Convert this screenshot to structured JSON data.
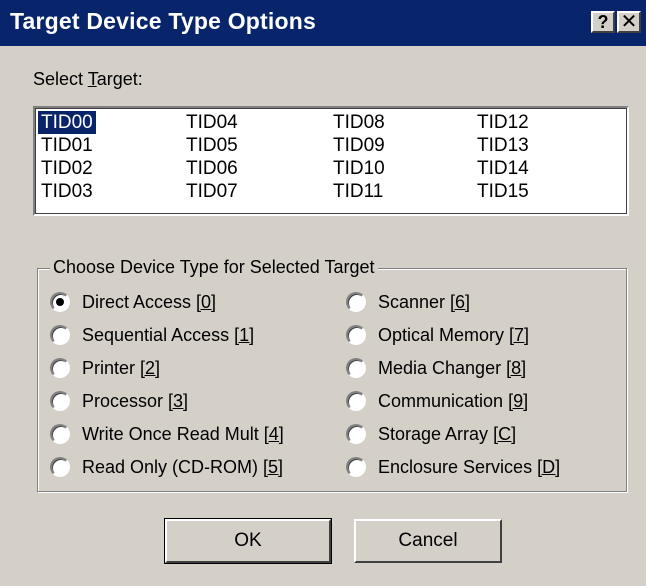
{
  "window": {
    "title": "Target Device Type Options",
    "help_glyph": "?",
    "close_glyph": "✕"
  },
  "select_target": {
    "label_prefix": "Select ",
    "label_accel": "T",
    "label_suffix": "arget:",
    "columns": [
      [
        "TID00",
        "TID01",
        "TID02",
        "TID03"
      ],
      [
        "TID04",
        "TID05",
        "TID06",
        "TID07"
      ],
      [
        "TID08",
        "TID09",
        "TID10",
        "TID11"
      ],
      [
        "TID12",
        "TID13",
        "TID14",
        "TID15"
      ]
    ],
    "selected": "TID00"
  },
  "device_type": {
    "group_label": "Choose Device Type for Selected Target",
    "left_options": [
      {
        "label": "Direct Access ",
        "key": "[0]",
        "checked": true
      },
      {
        "label": "Sequential Access ",
        "key": "[1]",
        "checked": false
      },
      {
        "label": "Printer ",
        "key": "[2]",
        "checked": false
      },
      {
        "label": "Processor ",
        "key": "[3]",
        "checked": false
      },
      {
        "label": "Write Once Read Mult ",
        "key": "[4]",
        "checked": false
      },
      {
        "label": "Read Only (CD-ROM) ",
        "key": "[5]",
        "checked": false
      }
    ],
    "right_options": [
      {
        "label": "Scanner ",
        "key": "[6]",
        "checked": false
      },
      {
        "label": "Optical Memory ",
        "key": "[7]",
        "checked": false
      },
      {
        "label": "Media Changer ",
        "key": "[8]",
        "checked": false
      },
      {
        "label": "Communication ",
        "key": "[9]",
        "checked": false
      },
      {
        "label": "Storage Array ",
        "key": "[C]",
        "checked": false
      },
      {
        "label": "Enclosure Services ",
        "key": "[D]",
        "checked": false
      }
    ]
  },
  "buttons": {
    "ok": "OK",
    "cancel": "Cancel"
  },
  "colors": {
    "title_bar": "#08246b",
    "selection": "#0a246a",
    "face": "#d4d0c8"
  }
}
